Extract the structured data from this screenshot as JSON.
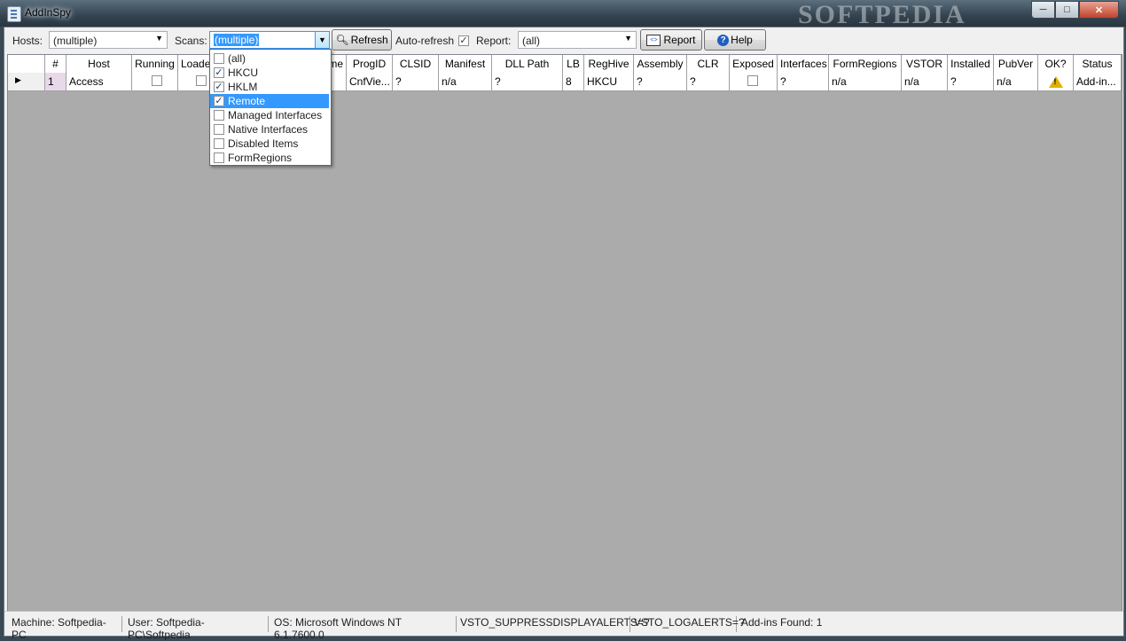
{
  "window": {
    "title": "AddInSpy",
    "brand": "SOFTPEDIA"
  },
  "toolbar": {
    "hosts_label": "Hosts:",
    "hosts_value": "(multiple)",
    "scans_label": "Scans:",
    "scans_value": "(multiple)",
    "refresh_label": "Refresh",
    "auto_refresh_label": "Auto-refresh",
    "auto_refresh_checked": true,
    "report_label": "Report:",
    "report_value": "(all)",
    "report_button": "Report",
    "help_button": "Help"
  },
  "scans_dropdown": {
    "items": [
      {
        "label": "(all)",
        "checked": false
      },
      {
        "label": "HKCU",
        "checked": true
      },
      {
        "label": "HKLM",
        "checked": true
      },
      {
        "label": "Remote",
        "checked": true,
        "highlighted": true
      },
      {
        "label": "Managed Interfaces",
        "checked": false
      },
      {
        "label": "Native Interfaces",
        "checked": false
      },
      {
        "label": "Disabled Items",
        "checked": false
      },
      {
        "label": "FormRegions",
        "checked": false
      }
    ]
  },
  "grid": {
    "columns": [
      "#",
      "Host",
      "Running",
      "Loaded",
      "FriendlyName",
      "ProgID",
      "CLSID",
      "Manifest",
      "DLL Path",
      "LB",
      "RegHive",
      "Assembly",
      "CLR",
      "Exposed",
      "Interfaces",
      "FormRegions",
      "VSTOR",
      "Installed",
      "PubVer",
      "OK?",
      "Status"
    ],
    "visible_columns": [
      "#",
      "Host",
      "Running",
      "Loade",
      "me",
      "ProgID",
      "CLSID",
      "Manifest",
      "DLL Path",
      "LB",
      "RegHive",
      "Assembly",
      "CLR",
      "Exposed",
      "Interfaces",
      "FormRegions",
      "VSTOR",
      "Installed",
      "PubVer",
      "OK?",
      "Status"
    ],
    "rows": [
      {
        "num": "1",
        "host": "Access",
        "running": false,
        "loaded": false,
        "progid": "CnfVie...",
        "clsid": "?",
        "manifest": "n/a",
        "dll_path": "?",
        "lb": "8",
        "reghive": "HKCU",
        "assembly": "?",
        "clr": "?",
        "exposed": false,
        "interfaces": "?",
        "formregions": "n/a",
        "vstor": "n/a",
        "installed": "?",
        "pubver": "n/a",
        "ok": "warning-icon",
        "status": "Add-in..."
      }
    ]
  },
  "statusbar": {
    "machine": "Machine: Softpedia-PC",
    "user": "User: Softpedia-PC\\Softpedia",
    "os": "OS: Microsoft Windows NT 6.1.7600.0",
    "suppress": "VSTO_SUPPRESSDISPLAYALERTS=?",
    "logalerts": "VSTO_LOGALERTS=?",
    "addins_found": "Add-ins Found: 1"
  }
}
